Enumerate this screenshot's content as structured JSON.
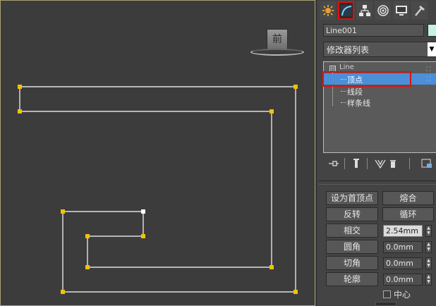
{
  "viewport": {
    "viewcube_label": "前",
    "shape_color": "#ffffff",
    "vertex_color": "#f2c200",
    "selected_vertex_color": "#ffffff"
  },
  "panel": {
    "tabs": [
      {
        "icon": "create-sun-icon",
        "active": false
      },
      {
        "icon": "modify-arc-icon",
        "active": true
      },
      {
        "icon": "hierarchy-icon",
        "active": false
      },
      {
        "icon": "motion-icon",
        "active": false
      },
      {
        "icon": "display-monitor-icon",
        "active": false
      },
      {
        "icon": "utilities-hammer-icon",
        "active": false
      }
    ],
    "object_name": "Line001",
    "object_color": "#c6f2e6",
    "modifier_list": "修改器列表",
    "stack": {
      "root": "Line",
      "root_toggle": "⊟",
      "items": [
        "顶点",
        "线段",
        "样条线"
      ],
      "selected": "顶点"
    },
    "highlight_color": "#e01010",
    "buttons": {
      "make_first": "设为首顶点",
      "fuse": "熔合",
      "reverse": "反转",
      "cycle": "循环",
      "intersect": "相交",
      "fillet": "圆角",
      "chamfer": "切角",
      "outline": "轮廓"
    },
    "fields": {
      "intersect_value": "2.54mm",
      "fillet_value": "0.0mm",
      "chamfer_value": "0.0mm",
      "outline_value": "0.0mm"
    },
    "center_label": "中心"
  }
}
